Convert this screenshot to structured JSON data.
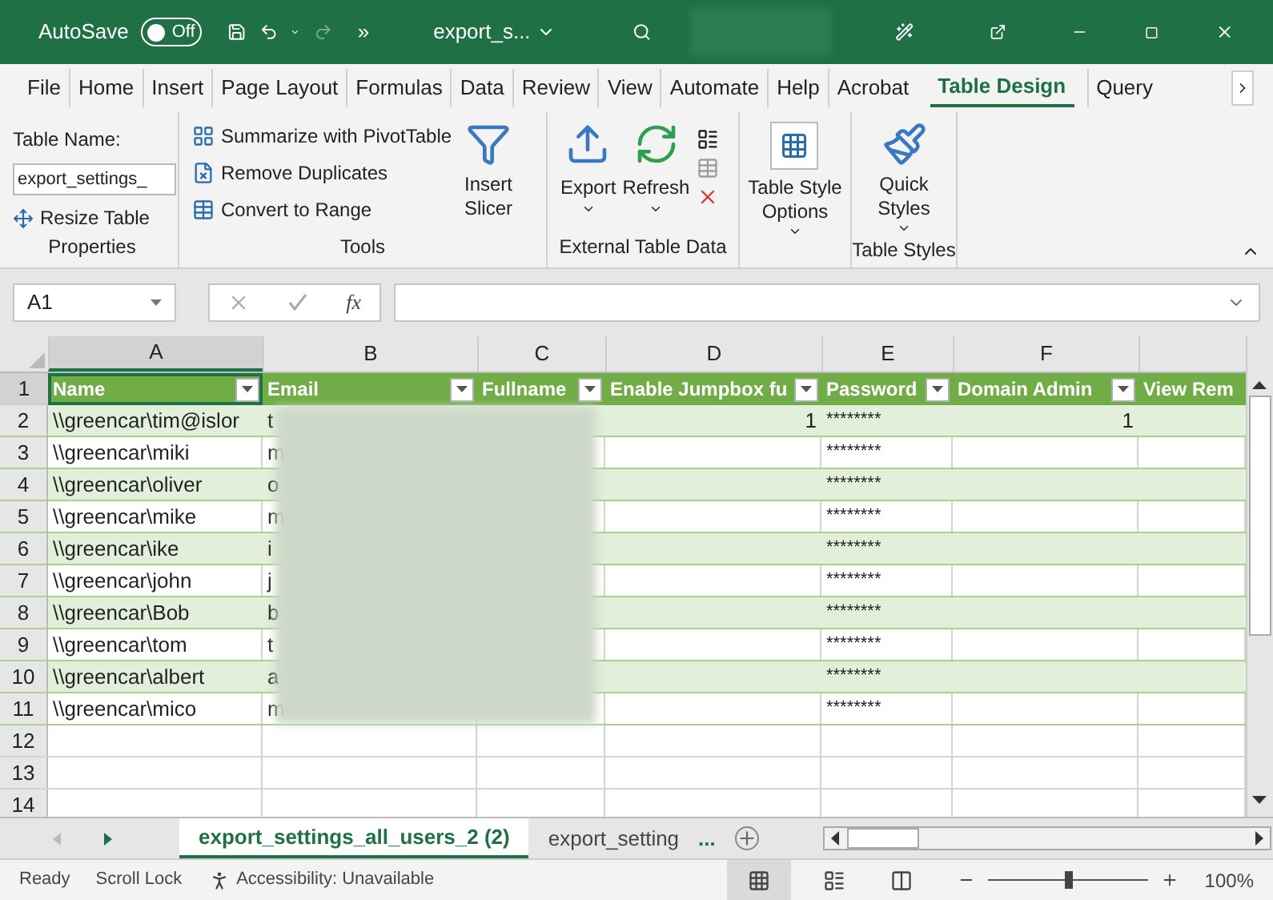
{
  "title_bar": {
    "autosave_label": "AutoSave",
    "autosave": {
      "label": "Off",
      "on": false
    },
    "overflow": "»",
    "file_name": "export_s..."
  },
  "menu_tabs": [
    {
      "label": "File",
      "selected": false
    },
    {
      "label": "Home",
      "selected": false
    },
    {
      "label": "Insert",
      "selected": false
    },
    {
      "label": "Page Layout",
      "selected": false
    },
    {
      "label": "Formulas",
      "selected": false
    },
    {
      "label": "Data",
      "selected": false
    },
    {
      "label": "Review",
      "selected": false
    },
    {
      "label": "View",
      "selected": false
    },
    {
      "label": "Automate",
      "selected": false
    },
    {
      "label": "Help",
      "selected": false
    },
    {
      "label": "Acrobat",
      "selected": false
    },
    {
      "label": "Table Design",
      "selected": true
    },
    {
      "label": "Query",
      "selected": false
    }
  ],
  "ribbon": {
    "properties": {
      "table_name_label": "Table Name:",
      "table_name": "export_settings_",
      "resize": "Resize Table",
      "group": "Properties"
    },
    "tools": {
      "items": [
        "Summarize with PivotTable",
        "Remove Duplicates",
        "Convert to Range"
      ],
      "slicer": [
        "Insert",
        "Slicer"
      ],
      "group": "Tools"
    },
    "external": {
      "export": "Export",
      "refresh": "Refresh",
      "group": "External Table Data"
    },
    "style_options": {
      "label": [
        "Table Style",
        "Options"
      ]
    },
    "styles": {
      "label": [
        "Quick",
        "Styles"
      ],
      "group": "Table Styles"
    }
  },
  "formula_bar": {
    "name_box": "A1",
    "function": "fx"
  },
  "column_letters": [
    "A",
    "B",
    "C",
    "D",
    "E",
    "F"
  ],
  "table": {
    "header_row_num": "1",
    "headers": [
      "Name",
      "Email",
      "Fullname",
      "Enable Jumpbox fu",
      "Password",
      "Domain Admin",
      "View Rem"
    ],
    "rows": [
      {
        "num": "2",
        "name": "\\\\greencar\\tim@islor",
        "email": "t",
        "jumpbox": "1",
        "password": "********",
        "domain_admin": "1"
      },
      {
        "num": "3",
        "name": "\\\\greencar\\miki",
        "email": "m",
        "password": "********"
      },
      {
        "num": "4",
        "name": "\\\\greencar\\oliver",
        "email": "o",
        "password": "********"
      },
      {
        "num": "5",
        "name": "\\\\greencar\\mike",
        "email": "m",
        "password": "********"
      },
      {
        "num": "6",
        "name": "\\\\greencar\\ike",
        "email": "i",
        "password": "********"
      },
      {
        "num": "7",
        "name": "\\\\greencar\\john",
        "email": "j",
        "password": "********"
      },
      {
        "num": "8",
        "name": "\\\\greencar\\Bob",
        "email": "b",
        "password": "********"
      },
      {
        "num": "9",
        "name": "\\\\greencar\\tom",
        "email": "t",
        "password": "********"
      },
      {
        "num": "10",
        "name": "\\\\greencar\\albert",
        "email": "a",
        "password": "********"
      },
      {
        "num": "11",
        "name": "\\\\greencar\\mico",
        "email": "m",
        "password": "********"
      }
    ],
    "empty_rows": [
      "12",
      "13",
      "14"
    ]
  },
  "sheet_tabs": [
    {
      "label": "export_settings_all_users_2 (2)",
      "selected": true
    },
    {
      "label": "export_setting",
      "selected": false
    }
  ],
  "more_sheets": "...",
  "status_bar": {
    "ready": "Ready",
    "scroll_lock": "Scroll Lock",
    "accessibility": "Accessibility: Unavailable",
    "zoom": "100%",
    "zoom_level": {
      "level": 0.5
    }
  }
}
